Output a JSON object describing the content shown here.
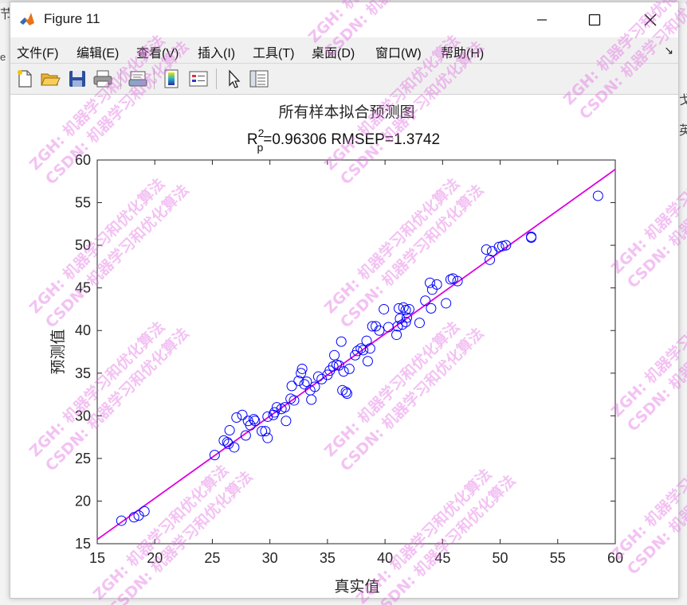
{
  "background": {
    "left_glyph_top": "节",
    "left_glyph_mid": "e",
    "right_glyph_1": "戈",
    "right_glyph_2": "英"
  },
  "window": {
    "title": "Figure 11",
    "menu": [
      "文件(F)",
      "编辑(E)",
      "查看(V)",
      "插入(I)",
      "工具(T)",
      "桌面(D)",
      "窗口(W)",
      "帮助(H)"
    ],
    "toolbar_icons": [
      "new-file-icon",
      "open-folder-icon",
      "save-icon",
      "print-icon",
      "print-preview-icon",
      "colorbar-icon",
      "legend-icon",
      "pointer-icon",
      "property-inspector-icon"
    ]
  },
  "chart_data": {
    "type": "scatter",
    "title": "所有样本拟合预测图",
    "subtitle": {
      "r_label": "R",
      "r_sup": "2",
      "r_sub": "p",
      "rest": "=0.96306  RMSEP=1.3742"
    },
    "xlabel": "真实值",
    "ylabel": "预测值",
    "xlim": [
      15,
      60
    ],
    "ylim": [
      15,
      60
    ],
    "xticks": [
      15,
      20,
      25,
      30,
      35,
      40,
      45,
      50,
      55,
      60
    ],
    "yticks": [
      15,
      20,
      25,
      30,
      35,
      40,
      45,
      50,
      55,
      60
    ],
    "grid": false,
    "marker_color": "#0000ff",
    "line_color": "#e000e0",
    "fit_line": {
      "x": [
        15,
        60
      ],
      "y": [
        15.5,
        58.9
      ]
    },
    "points": [
      [
        17.1,
        17.7
      ],
      [
        18.2,
        18.1
      ],
      [
        18.6,
        18.3
      ],
      [
        19.1,
        18.8
      ],
      [
        25.2,
        25.4
      ],
      [
        26.0,
        27.1
      ],
      [
        26.3,
        26.9
      ],
      [
        26.5,
        28.3
      ],
      [
        26.4,
        26.7
      ],
      [
        26.9,
        26.3
      ],
      [
        27.1,
        29.8
      ],
      [
        27.6,
        30.1
      ],
      [
        27.9,
        27.7
      ],
      [
        28.1,
        29.4
      ],
      [
        28.3,
        28.9
      ],
      [
        28.6,
        29.6
      ],
      [
        28.7,
        29.4
      ],
      [
        29.3,
        28.2
      ],
      [
        29.6,
        28.2
      ],
      [
        29.8,
        27.4
      ],
      [
        29.8,
        29.9
      ],
      [
        30.3,
        30.1
      ],
      [
        30.4,
        30.4
      ],
      [
        30.6,
        31.0
      ],
      [
        31.0,
        30.8
      ],
      [
        31.3,
        31.0
      ],
      [
        31.4,
        29.4
      ],
      [
        31.8,
        32.0
      ],
      [
        31.9,
        33.5
      ],
      [
        32.1,
        31.8
      ],
      [
        32.5,
        34.1
      ],
      [
        32.7,
        35.0
      ],
      [
        32.8,
        35.5
      ],
      [
        33.0,
        33.7
      ],
      [
        33.2,
        34.0
      ],
      [
        33.5,
        33.0
      ],
      [
        33.6,
        31.9
      ],
      [
        33.9,
        33.4
      ],
      [
        34.2,
        34.6
      ],
      [
        34.5,
        34.3
      ],
      [
        35.0,
        34.8
      ],
      [
        35.2,
        35.3
      ],
      [
        35.5,
        35.8
      ],
      [
        35.6,
        37.1
      ],
      [
        35.8,
        36.0
      ],
      [
        36.0,
        35.9
      ],
      [
        36.2,
        38.7
      ],
      [
        36.3,
        33.0
      ],
      [
        36.4,
        35.2
      ],
      [
        36.6,
        32.8
      ],
      [
        36.7,
        32.6
      ],
      [
        36.9,
        35.5
      ],
      [
        37.4,
        37.1
      ],
      [
        37.6,
        37.6
      ],
      [
        37.9,
        37.9
      ],
      [
        38.1,
        37.7
      ],
      [
        38.4,
        38.8
      ],
      [
        38.5,
        36.4
      ],
      [
        38.7,
        37.9
      ],
      [
        38.9,
        40.5
      ],
      [
        39.2,
        40.5
      ],
      [
        39.5,
        40.0
      ],
      [
        39.9,
        42.5
      ],
      [
        40.3,
        40.4
      ],
      [
        41.0,
        39.5
      ],
      [
        41.1,
        40.5
      ],
      [
        41.2,
        42.6
      ],
      [
        41.3,
        41.4
      ],
      [
        41.5,
        40.7
      ],
      [
        41.6,
        42.7
      ],
      [
        41.8,
        42.4
      ],
      [
        42.1,
        42.5
      ],
      [
        41.9,
        41.5
      ],
      [
        41.8,
        41.0
      ],
      [
        43.0,
        40.9
      ],
      [
        43.5,
        43.5
      ],
      [
        43.9,
        45.6
      ],
      [
        44.0,
        42.6
      ],
      [
        44.1,
        44.8
      ],
      [
        44.5,
        45.4
      ],
      [
        45.3,
        43.2
      ],
      [
        45.7,
        46.0
      ],
      [
        45.9,
        46.1
      ],
      [
        46.3,
        45.8
      ],
      [
        48.8,
        49.5
      ],
      [
        49.1,
        48.3
      ],
      [
        49.3,
        49.3
      ],
      [
        49.9,
        49.8
      ],
      [
        50.2,
        49.9
      ],
      [
        50.5,
        50.0
      ],
      [
        52.7,
        50.9
      ],
      [
        52.7,
        51.0
      ],
      [
        58.5,
        55.8
      ]
    ]
  },
  "watermarks": [
    "ZGH: 机器学习和优化算法",
    "CSDN: 机器学习和优化算法"
  ],
  "colors": {
    "matlab_icon_orange": "#e8731a",
    "matlab_icon_blue": "#2a6fb7",
    "watermark": "#e26ee2"
  }
}
